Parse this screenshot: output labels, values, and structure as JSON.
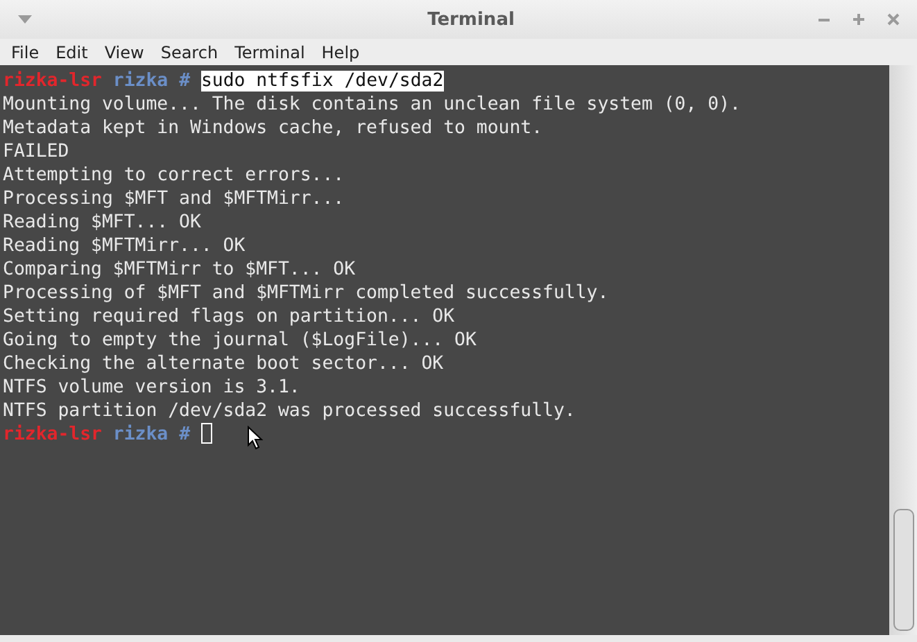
{
  "window": {
    "title": "Terminal"
  },
  "menu": [
    "File",
    "Edit",
    "View",
    "Search",
    "Terminal",
    "Help"
  ],
  "terminal": {
    "lines": [
      {
        "kind": "prompt",
        "host": "rizka-lsr",
        "user": "rizka",
        "symbol": "#",
        "command": "sudo ntfsfix /dev/sda2",
        "selected": true
      },
      {
        "kind": "output",
        "text": "Mounting volume... The disk contains an unclean file system (0, 0)."
      },
      {
        "kind": "output",
        "text": "Metadata kept in Windows cache, refused to mount."
      },
      {
        "kind": "output",
        "text": "FAILED"
      },
      {
        "kind": "output",
        "text": "Attempting to correct errors..."
      },
      {
        "kind": "output",
        "text": "Processing $MFT and $MFTMirr..."
      },
      {
        "kind": "output",
        "text": "Reading $MFT... OK"
      },
      {
        "kind": "output",
        "text": "Reading $MFTMirr... OK"
      },
      {
        "kind": "output",
        "text": "Comparing $MFTMirr to $MFT... OK"
      },
      {
        "kind": "output",
        "text": "Processing of $MFT and $MFTMirr completed successfully."
      },
      {
        "kind": "output",
        "text": "Setting required flags on partition... OK"
      },
      {
        "kind": "output",
        "text": "Going to empty the journal ($LogFile)... OK"
      },
      {
        "kind": "output",
        "text": "Checking the alternate boot sector... OK"
      },
      {
        "kind": "output",
        "text": "NTFS volume version is 3.1."
      },
      {
        "kind": "output",
        "text": "NTFS partition /dev/sda2 was processed successfully."
      },
      {
        "kind": "prompt",
        "host": "rizka-lsr",
        "user": "rizka",
        "symbol": "#",
        "cursor": true
      }
    ]
  }
}
